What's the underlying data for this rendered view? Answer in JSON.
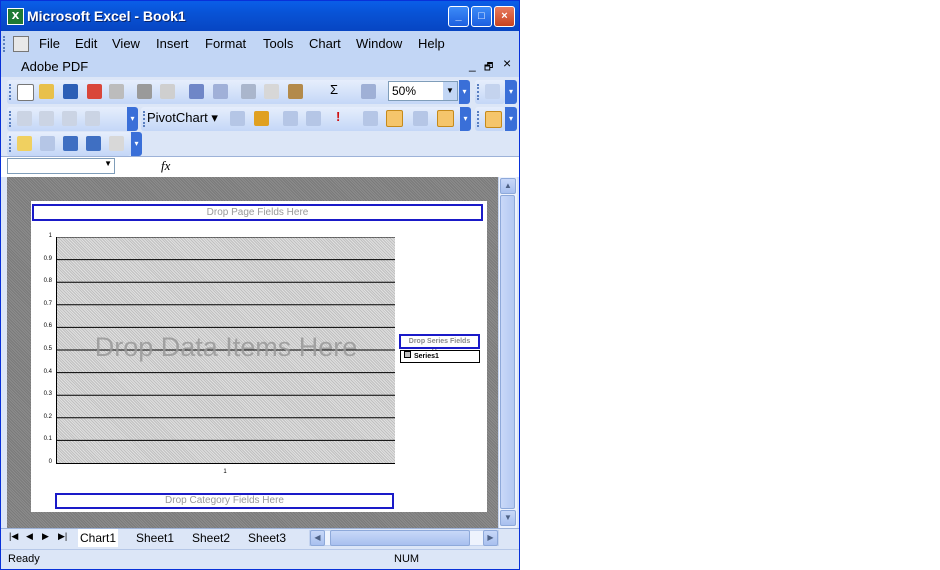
{
  "window": {
    "title": "Microsoft Excel - Book1",
    "app_icon": "excel-icon"
  },
  "menu": {
    "items": [
      "File",
      "Edit",
      "View",
      "Insert",
      "Format",
      "Tools",
      "Chart",
      "Window",
      "Help"
    ],
    "addin": "Adobe PDF",
    "min_glyph": "_",
    "restore_glyph": "🗗",
    "close_glyph": "×"
  },
  "toolbar": {
    "zoom": "50%",
    "pivotchart_label": "PivotChart"
  },
  "formula": {
    "fx": "fx",
    "name_value": ""
  },
  "chart_data": {
    "type": "bar",
    "categories": [
      "1"
    ],
    "series": [
      {
        "name": "Series1",
        "values": [
          0
        ]
      }
    ],
    "ylim": [
      0,
      1
    ],
    "yticks": [
      "0",
      "0.1",
      "0.2",
      "0.3",
      "0.4",
      "0.5",
      "0.6",
      "0.7",
      "0.8",
      "0.9",
      "1"
    ],
    "grid": true,
    "legend": "right",
    "page_drop": "Drop Page Fields Here",
    "data_drop": "Drop Data Items Here",
    "series_drop": "Drop Series Fields Here",
    "category_drop": "Drop Category Fields Here"
  },
  "sheets": {
    "tabs": [
      "Chart1",
      "Sheet1",
      "Sheet2",
      "Sheet3"
    ],
    "active": "Chart1"
  },
  "status": {
    "left": "Ready",
    "num": "NUM"
  }
}
